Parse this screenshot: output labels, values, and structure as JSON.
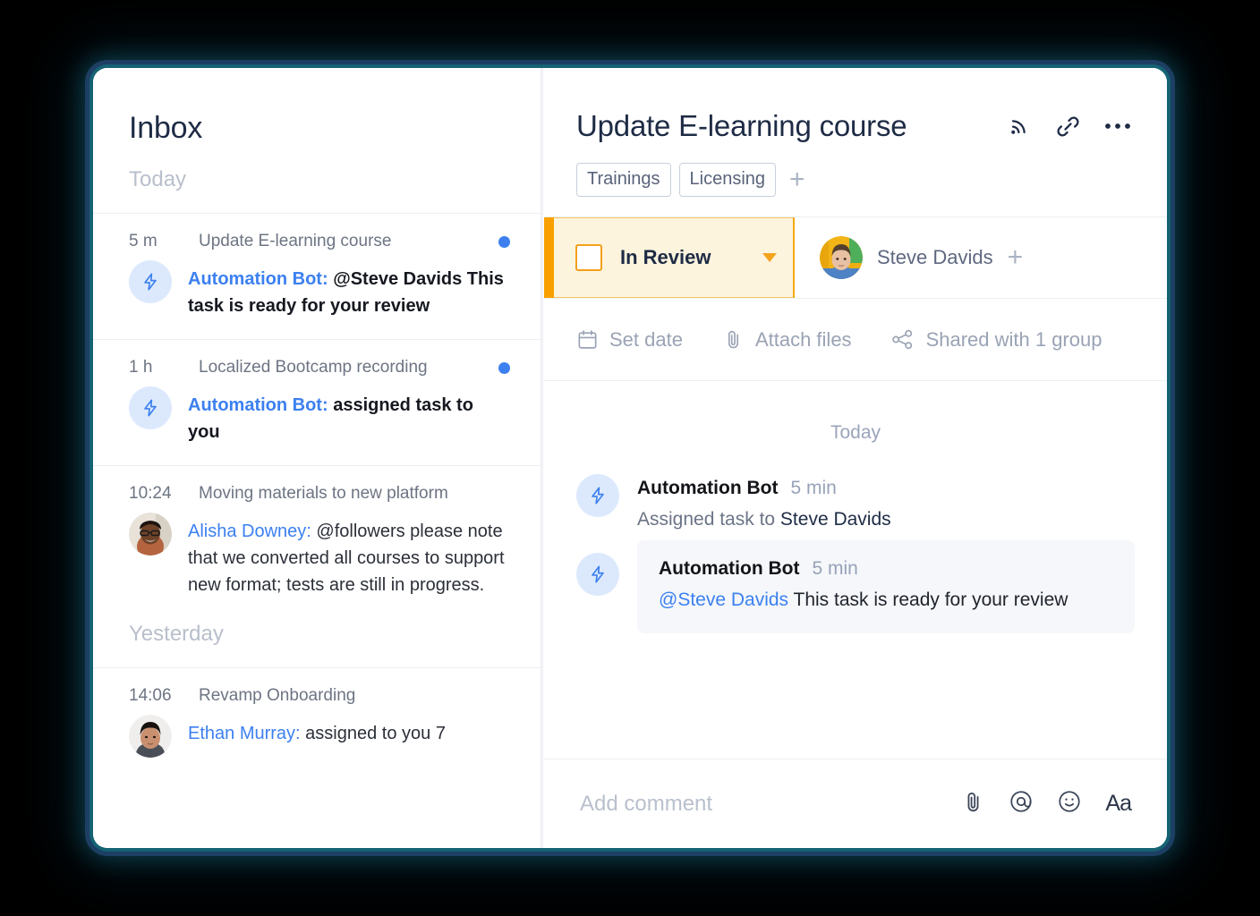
{
  "inbox": {
    "title": "Inbox",
    "groups": [
      {
        "label": "Today"
      },
      {
        "label": "Yesterday"
      }
    ],
    "items": [
      {
        "time": "5 m",
        "subject": "Update E-learning course",
        "unread": true,
        "avatar": "bolt-icon",
        "sender": "Automation Bot:",
        "message": " @Steve Davids This task is ready for your review",
        "bold": true
      },
      {
        "time": "1 h",
        "subject": "Localized Bootcamp recording",
        "unread": true,
        "avatar": "bolt-icon",
        "sender": "Automation Bot:",
        "message": " assigned task to you",
        "bold": true
      },
      {
        "time": "10:24",
        "subject": "Moving materials to new platform",
        "unread": false,
        "avatar": "photo-alisha",
        "sender": "Alisha Downey:",
        "message": " @followers please note that we converted all courses to support new format; tests are still in progress.",
        "bold": false
      },
      {
        "time": "14:06",
        "subject": "Revamp Onboarding",
        "unread": false,
        "avatar": "photo-ethan",
        "sender": "Ethan Murray:",
        "message": " assigned to you 7",
        "bold": false
      }
    ]
  },
  "task": {
    "title": "Update E-learning course",
    "header_icons": [
      {
        "name": "follow-icon"
      },
      {
        "name": "link-icon"
      },
      {
        "name": "more-icon"
      }
    ],
    "tags": [
      "Trainings",
      "Licensing"
    ],
    "tag_add_label": "+",
    "status": {
      "label": "In Review",
      "accent_color": "#f9a000",
      "background_color": "#fdf4dd",
      "border_color": "#f4a911"
    },
    "assignee": {
      "name": "Steve Davids",
      "add_label": "+"
    },
    "actions": [
      {
        "icon": "calendar-icon",
        "label": "Set date"
      },
      {
        "icon": "paperclip-icon",
        "label": "Attach files"
      },
      {
        "icon": "share-icon",
        "label": "Shared with 1 group"
      }
    ],
    "feed": {
      "day_label": "Today",
      "entries": [
        {
          "author": "Automation Bot",
          "time": "5 min",
          "text_prefix": "Assigned task to ",
          "text_strong": "Steve Davids",
          "mention": "",
          "highlighted": false
        },
        {
          "author": "Automation Bot",
          "time": "5 min",
          "text_prefix": "",
          "text_strong": " This task is ready for your review",
          "mention": "@Steve Davids",
          "highlighted": true
        }
      ]
    },
    "comment": {
      "placeholder": "Add comment",
      "icons": [
        {
          "name": "paperclip-icon"
        },
        {
          "name": "mention-icon"
        },
        {
          "name": "emoji-icon"
        },
        {
          "name": "format-text-icon",
          "label": "Aa"
        }
      ]
    }
  },
  "theme": {
    "accent_blue": "#3c80f0",
    "accent_orange": "#f9a000",
    "text_dark": "#1e2b45",
    "text_muted": "#6d7483"
  }
}
